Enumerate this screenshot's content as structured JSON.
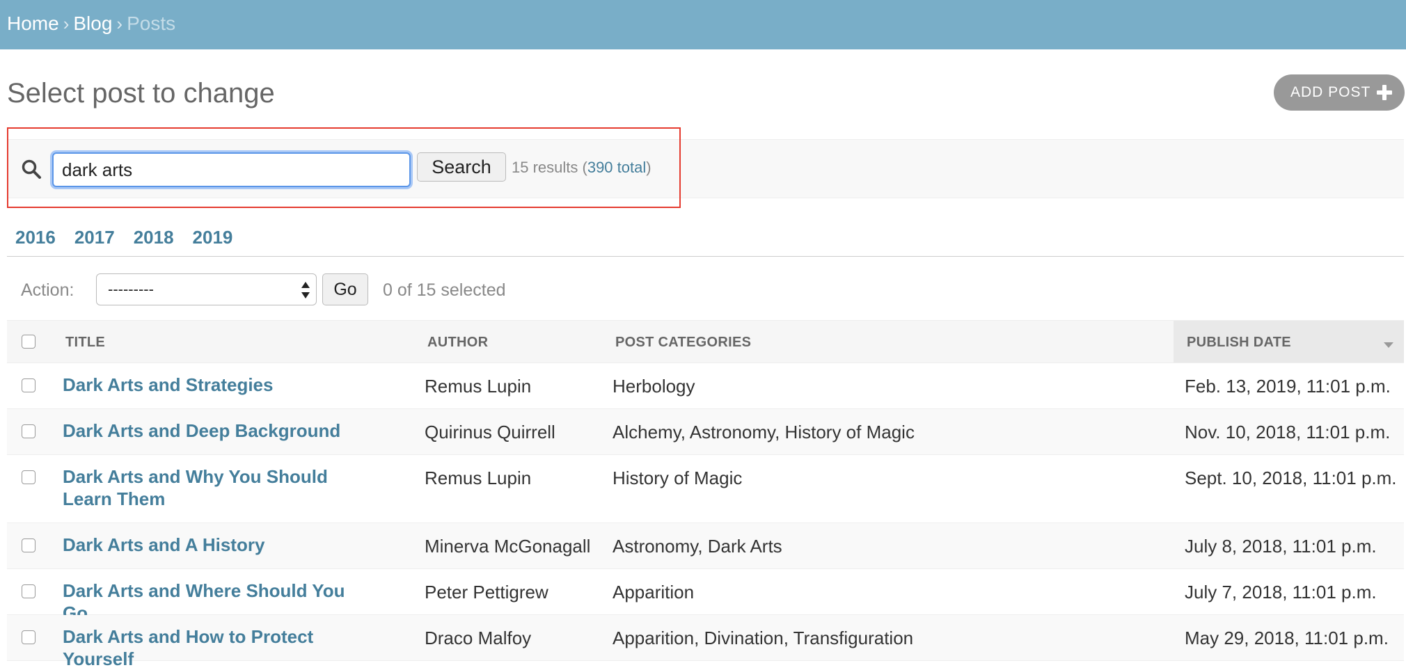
{
  "breadcrumb": {
    "items": [
      "Home",
      "Blog",
      "Posts"
    ],
    "separator": "›"
  },
  "page": {
    "title": "Select post to change",
    "add_button_label": "ADD POST"
  },
  "search": {
    "value": "dark arts",
    "button_label": "Search",
    "result_prefix": "15 results (",
    "total_link": "390 total",
    "result_suffix": ")"
  },
  "date_hierarchy": [
    "2016",
    "2017",
    "2018",
    "2019"
  ],
  "actions": {
    "label": "Action:",
    "selected_option": "---------",
    "go_label": "Go",
    "selected_count": "0 of 15 selected"
  },
  "table": {
    "columns": [
      "TITLE",
      "AUTHOR",
      "POST CATEGORIES",
      "PUBLISH DATE"
    ],
    "rows": [
      {
        "title": "Dark Arts and Strategies",
        "author": "Remus Lupin",
        "categories": "Herbology",
        "date": "Feb. 13, 2019, 11:01 p.m."
      },
      {
        "title": "Dark Arts and Deep Background",
        "author": "Quirinus Quirrell",
        "categories": "Alchemy, Astronomy, History of Magic",
        "date": "Nov. 10, 2018, 11:01 p.m."
      },
      {
        "title": "Dark Arts and Why You Should Learn Them",
        "author": "Remus Lupin",
        "categories": "History of Magic",
        "date": "Sept. 10, 2018, 11:01 p.m."
      },
      {
        "title": "Dark Arts and A History",
        "author": "Minerva McGonagall",
        "categories": "Astronomy, Dark Arts",
        "date": "July 8, 2018, 11:01 p.m."
      },
      {
        "title": "Dark Arts and Where Should You Go",
        "author": "Peter Pettigrew",
        "categories": "Apparition",
        "date": "July 7, 2018, 11:01 p.m."
      },
      {
        "title": "Dark Arts and How to Protect Yourself",
        "author": "Draco Malfoy",
        "categories": "Apparition, Divination, Transfiguration",
        "date": "May 29, 2018, 11:01 p.m."
      }
    ]
  },
  "icons": {
    "search": "search-icon",
    "add": "plus-icon",
    "sort": "sort-descending-icon",
    "select_arrows": "select-arrows-icon"
  },
  "colors": {
    "header_bar": "#79aec8",
    "link": "#447e9b",
    "highlight_box": "#e53a2e",
    "add_button": "#999999"
  }
}
